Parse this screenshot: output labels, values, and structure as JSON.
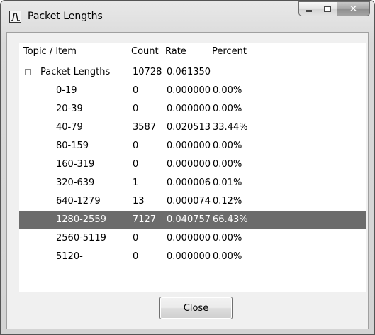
{
  "window": {
    "title": "Packet Lengths"
  },
  "columns": {
    "topic": "Topic / Item",
    "count": "Count",
    "rate": "Rate",
    "percent": "Percent"
  },
  "root": {
    "label": "Packet Lengths",
    "count": "10728",
    "rate": "0.061350",
    "percent": ""
  },
  "rows": [
    {
      "label": "0-19",
      "count": "0",
      "rate": "0.000000",
      "percent": "0.00%"
    },
    {
      "label": "20-39",
      "count": "0",
      "rate": "0.000000",
      "percent": "0.00%"
    },
    {
      "label": "40-79",
      "count": "3587",
      "rate": "0.020513",
      "percent": "33.44%"
    },
    {
      "label": "80-159",
      "count": "0",
      "rate": "0.000000",
      "percent": "0.00%"
    },
    {
      "label": "160-319",
      "count": "0",
      "rate": "0.000000",
      "percent": "0.00%"
    },
    {
      "label": "320-639",
      "count": "1",
      "rate": "0.000006",
      "percent": "0.01%"
    },
    {
      "label": "640-1279",
      "count": "13",
      "rate": "0.000074",
      "percent": "0.12%"
    },
    {
      "label": "1280-2559",
      "count": "7127",
      "rate": "0.040757",
      "percent": "66.43%"
    },
    {
      "label": "2560-5119",
      "count": "0",
      "rate": "0.000000",
      "percent": "0.00%"
    },
    {
      "label": "5120-",
      "count": "0",
      "rate": "0.000000",
      "percent": "0.00%"
    }
  ],
  "selected_row": "1280-2559",
  "buttons": {
    "close_mnemonic": "C",
    "close_rest": "lose"
  },
  "colors": {
    "selection": "#6c6c6c"
  },
  "icons": {
    "app": "chart-line-icon",
    "minimize": "minimize-icon",
    "maximize": "maximize-icon",
    "close": "close-icon",
    "expander": "collapse-icon"
  }
}
